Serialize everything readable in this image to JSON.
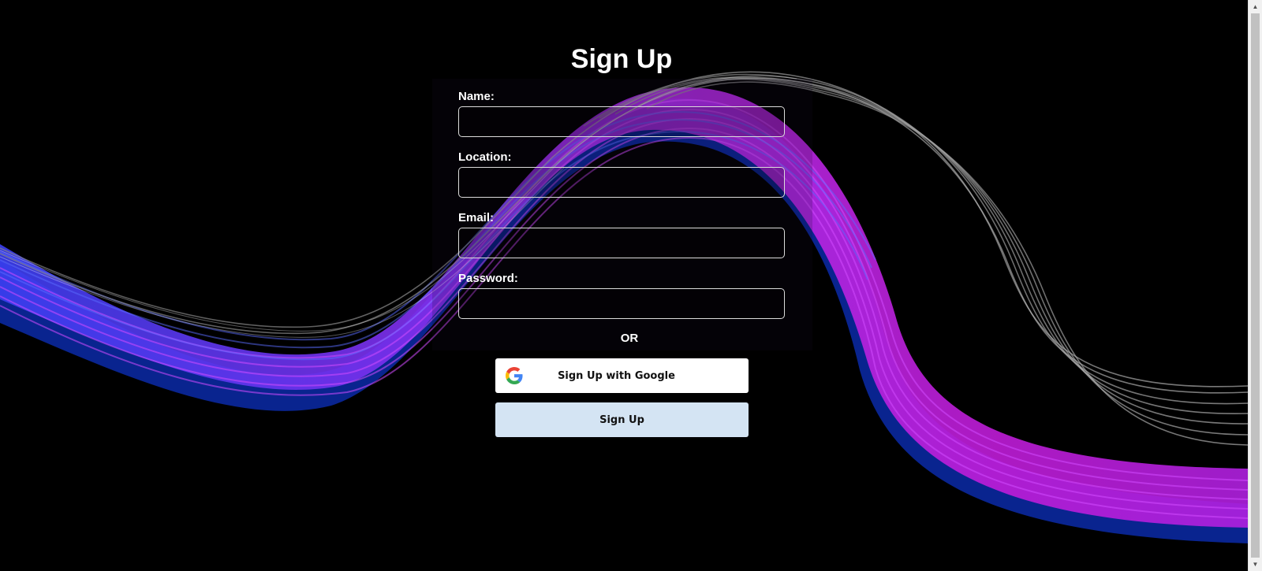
{
  "page": {
    "title": "Sign Up"
  },
  "form": {
    "fields": [
      {
        "label": "Name:",
        "value": "",
        "placeholder": ""
      },
      {
        "label": "Location:",
        "value": "",
        "placeholder": ""
      },
      {
        "label": "Email:",
        "value": "",
        "placeholder": ""
      },
      {
        "label": "Password:",
        "value": "",
        "placeholder": ""
      }
    ],
    "separator": "OR",
    "google_button": "Sign Up with Google",
    "signup_button": "Sign Up"
  },
  "icons": {
    "google": "google-g-icon"
  },
  "colors": {
    "background": "#000000",
    "signup_button": "#d4e4f3",
    "google_button": "#ffffff",
    "wave_purple": "#b327f0",
    "wave_blue": "#2a3ae0"
  }
}
